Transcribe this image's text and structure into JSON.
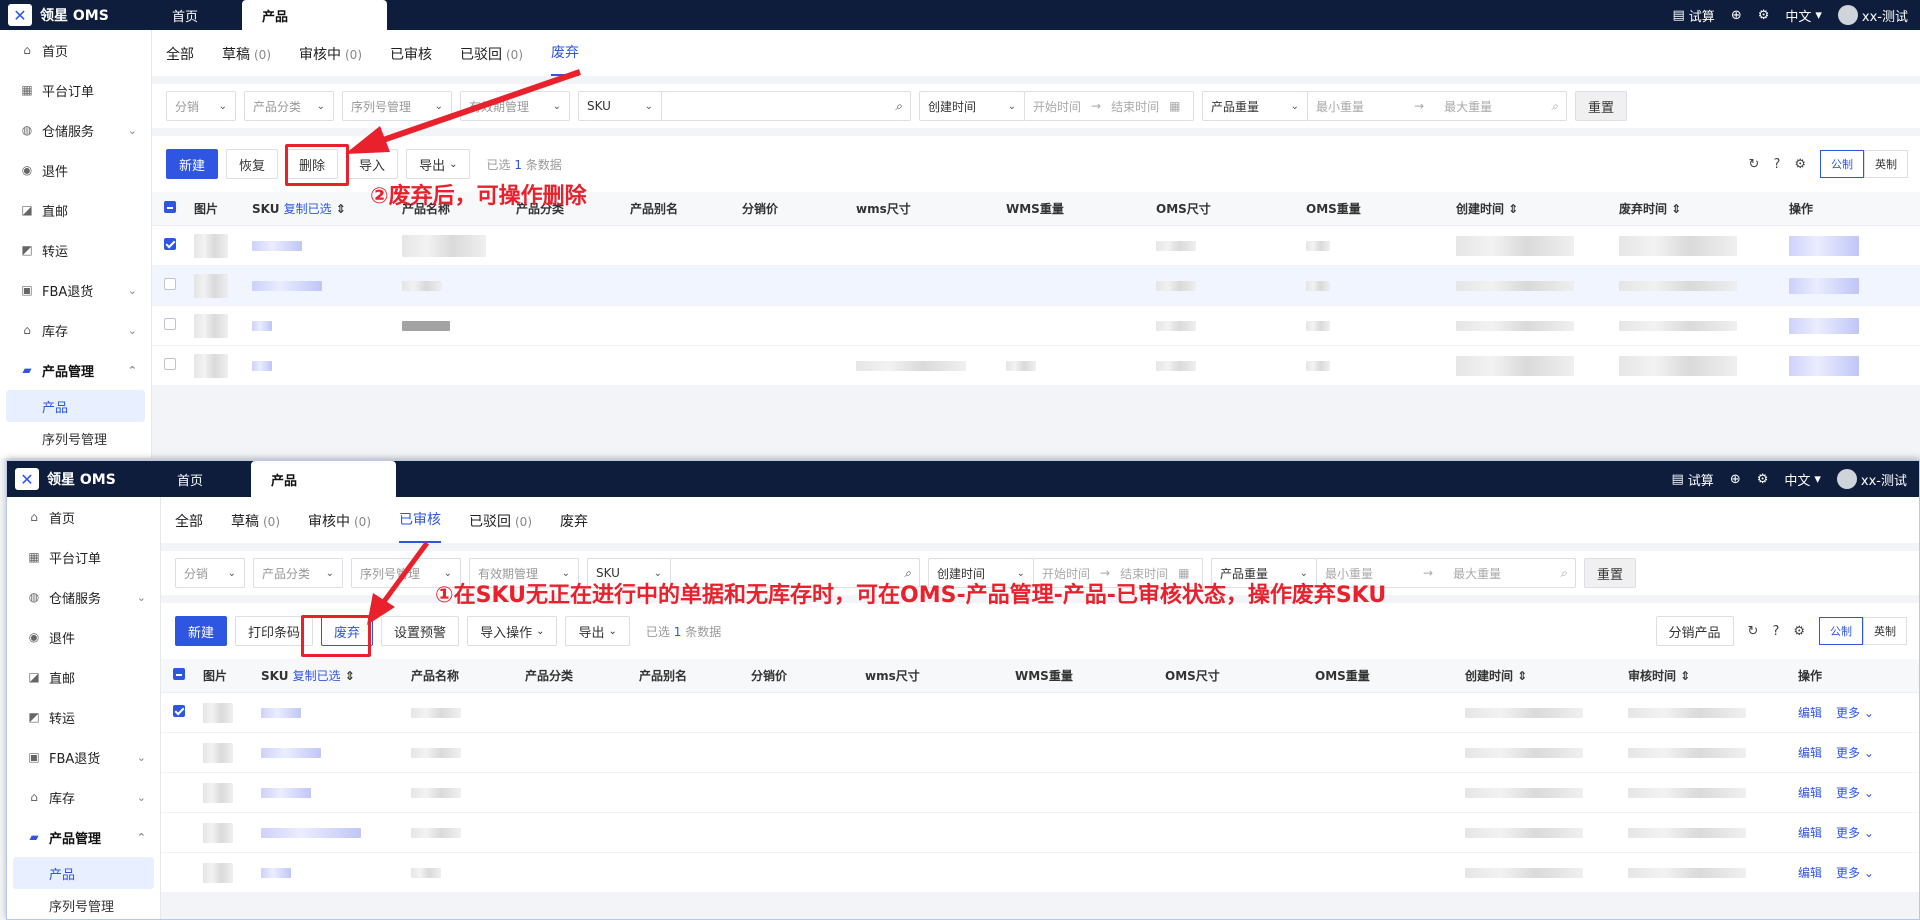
{
  "app": {
    "brand": "领星 OMS",
    "tab_home": "首页",
    "tab_product": "产品",
    "trial": "试算",
    "lang": "中文",
    "user": "xx-测试"
  },
  "sidebar": {
    "items": [
      {
        "label": "首页",
        "icon": "home-icon"
      },
      {
        "label": "平台订单",
        "icon": "clipboard-icon"
      },
      {
        "label": "仓储服务",
        "icon": "warehouse-icon"
      },
      {
        "label": "退件",
        "icon": "return-icon"
      },
      {
        "label": "直邮",
        "icon": "mail-icon"
      },
      {
        "label": "转运",
        "icon": "transfer-icon"
      },
      {
        "label": "FBA退货",
        "icon": "fba-icon"
      },
      {
        "label": "库存",
        "icon": "inventory-icon"
      },
      {
        "label": "产品管理",
        "icon": "product-icon"
      }
    ],
    "sub_product": "产品",
    "sub_serial": "序列号管理"
  },
  "status_tabs": {
    "all": "全部",
    "draft": "草稿",
    "review": "审核中",
    "approved": "已审核",
    "rejected": "已驳回",
    "abandoned": "废弃",
    "count": "(0)"
  },
  "filters": {
    "distribution": "分销",
    "category": "产品分类",
    "serial": "序列号管理",
    "expiry": "有效期管理",
    "sku": "SKU",
    "created_time": "创建时间",
    "start": "开始时间",
    "end": "结束时间",
    "weight": "产品重量",
    "min_w": "最小重量",
    "max_w": "最大重量",
    "reset": "重置"
  },
  "top_toolbar": {
    "new": "新建",
    "restore": "恢复",
    "delete": "删除",
    "import": "导入",
    "export": "导出",
    "selected_prefix": "已选",
    "selected_count": "1",
    "selected_suffix": "条数据"
  },
  "bottom_toolbar": {
    "new": "新建",
    "print": "打印条码",
    "abandon": "废弃",
    "alert": "设置预警",
    "import_op": "导入操作",
    "export": "导出",
    "selected_prefix": "已选",
    "selected_count": "1",
    "selected_suffix": "条数据",
    "dist_product": "分销产品"
  },
  "units": {
    "metric": "公制",
    "imperial": "英制"
  },
  "columns": {
    "image": "图片",
    "sku": "SKU",
    "copy": "复制已选",
    "name": "产品名称",
    "category": "产品分类",
    "alias": "产品别名",
    "price": "分销价",
    "wms_size": "wms尺寸",
    "wms_weight": "WMS重量",
    "oms_size": "OMS尺寸",
    "oms_weight": "OMS重量",
    "created": "创建时间",
    "abandon_time": "废弃时间",
    "review_time": "审核时间",
    "ops": "操作"
  },
  "row_ops": {
    "edit": "编辑",
    "more": "更多"
  },
  "annotations": {
    "step1": "①在SKU无正在进行中的单据和无库存时，可在OMS-产品管理-产品-已审核状态，操作废弃SKU",
    "step2": "②废弃后，可操作删除"
  },
  "colors": {
    "primary": "#2f56e0",
    "topbar": "#0f1d3d",
    "annotation": "#e8212c"
  }
}
